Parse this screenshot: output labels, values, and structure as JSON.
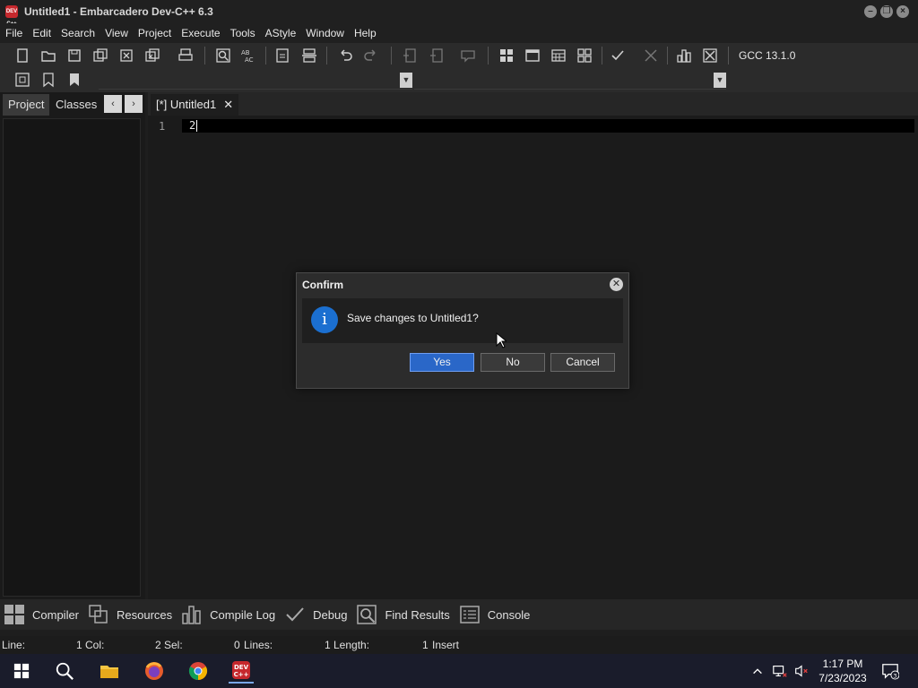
{
  "window": {
    "title": "Untitled1 - Embarcadero Dev-C++ 6.3",
    "app_icon_text": "DEV C++"
  },
  "menu": [
    "File",
    "Edit",
    "Search",
    "View",
    "Project",
    "Execute",
    "Tools",
    "AStyle",
    "Window",
    "Help"
  ],
  "toolbar": {
    "compiler": "GCC 13.1.0",
    "icons": [
      "new-file-icon",
      "open-file-icon",
      "save-icon",
      "save-all-icon",
      "close-icon",
      "close-all-icon",
      "print-icon",
      "find-icon",
      "replace-icon",
      "indent-icon",
      "unindent-icon",
      "undo-icon",
      "redo-icon",
      "new-project-icon",
      "remove-project-icon",
      "comment-icon",
      "layout-grid-icon",
      "window-icon",
      "calendar-icon",
      "grid-icon",
      "check-icon",
      "cross-icon",
      "chart-icon",
      "delete-icon"
    ]
  },
  "left_panel": {
    "tabs": [
      "Project",
      "Classes"
    ],
    "nav_prev": "‹",
    "nav_next": "›"
  },
  "editor": {
    "tab_label": "[*] Untitled1",
    "tab_close": "✕",
    "line_number": "1",
    "code": "2"
  },
  "bottom_tabs": [
    "Compiler",
    "Resources",
    "Compile Log",
    "Debug",
    "Find Results",
    "Console"
  ],
  "status": {
    "line_label": "Line:",
    "line_value": "1",
    "col_label": "Col:",
    "col_value": "2",
    "sel_label": "Sel:",
    "sel_value": "0",
    "lines_label": "Lines:",
    "lines_value": "1",
    "length_label": "Length:",
    "length_value": "1",
    "mode": "Insert"
  },
  "dialog": {
    "title": "Confirm",
    "message": "Save changes to Untitled1?",
    "info_glyph": "i",
    "close_glyph": "✕",
    "yes": "Yes",
    "no": "No",
    "cancel": "Cancel"
  },
  "taskbar": {
    "time": "1:17 PM",
    "date": "7/23/2023",
    "notification_count": "3"
  },
  "colors": {
    "accent": "#2a67c8",
    "info": "#1b6fd0"
  }
}
